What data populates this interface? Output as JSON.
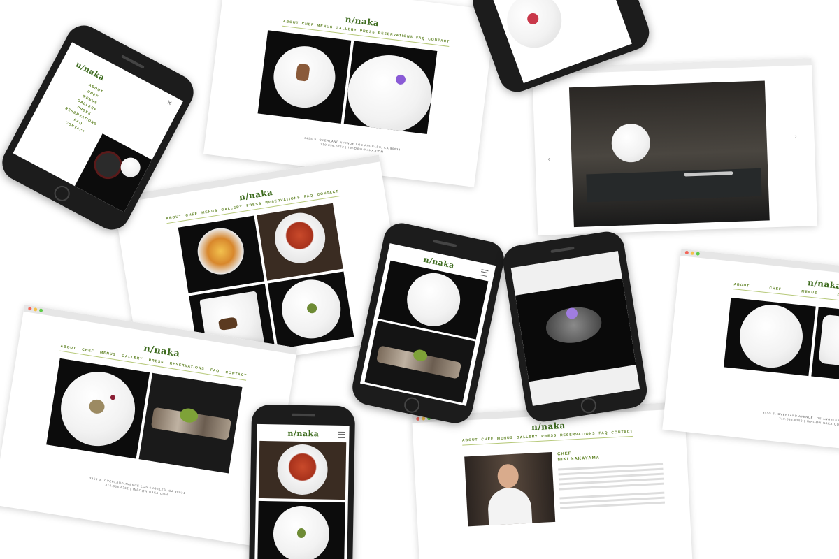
{
  "brand": {
    "logo": "n/naka"
  },
  "nav": {
    "items": [
      "ABOUT",
      "CHEF",
      "MENUS",
      "GALLERY",
      "PRESS",
      "RESERVATIONS",
      "FAQ",
      "CONTACT"
    ]
  },
  "footer": {
    "address": "3455 S. OVERLAND AVENUE LOS ANGELES, CA 90034",
    "contact": "310.836.6252 | INFO@N-NAKA.COM"
  },
  "chef_page": {
    "label": "CHEF",
    "name": "NIKI NAKAYAMA"
  },
  "slideshow": {
    "prev": "‹",
    "next": "›"
  },
  "mobile_menu": {
    "close": "×"
  },
  "colors": {
    "brand_green": "#3d6b1e",
    "nav_green": "#5b7f1f",
    "rule": "#b7c97a",
    "phone_body": "#1c1c1c"
  }
}
